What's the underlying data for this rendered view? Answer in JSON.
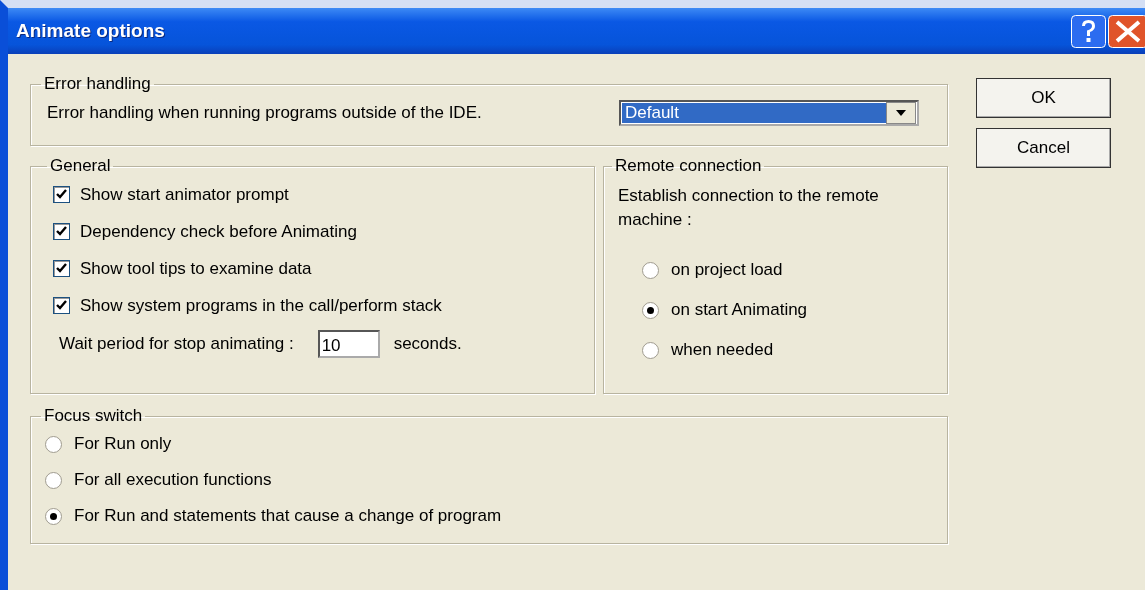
{
  "window": {
    "title": "Animate options"
  },
  "error_handling": {
    "title": "Error handling",
    "label": "Error handling when running programs outside of the IDE.",
    "select": {
      "value": "Default",
      "focused": true
    }
  },
  "general": {
    "title": "General",
    "options": [
      {
        "label": "Show start animator prompt",
        "checked": true
      },
      {
        "label": "Dependency check before Animating",
        "checked": true
      },
      {
        "label": "Show tool tips to examine data",
        "checked": true
      },
      {
        "label": "Show system programs in the call/perform stack",
        "checked": true
      }
    ],
    "wait": {
      "label": "Wait period for stop animating :",
      "value": "10",
      "unit": "seconds."
    }
  },
  "remote": {
    "title": "Remote connection",
    "prompt": "Establish connection to the remote machine :",
    "options": [
      {
        "label": "on project load",
        "selected": false
      },
      {
        "label": "on start Animating",
        "selected": true
      },
      {
        "label": "when needed",
        "selected": false
      }
    ]
  },
  "focus": {
    "title": "Focus switch",
    "options": [
      {
        "label": "For Run only",
        "selected": false
      },
      {
        "label": "For all execution functions",
        "selected": false
      },
      {
        "label": "For Run and statements that cause a change of program",
        "selected": true
      }
    ]
  },
  "buttons": [
    "OK",
    "Cancel"
  ]
}
